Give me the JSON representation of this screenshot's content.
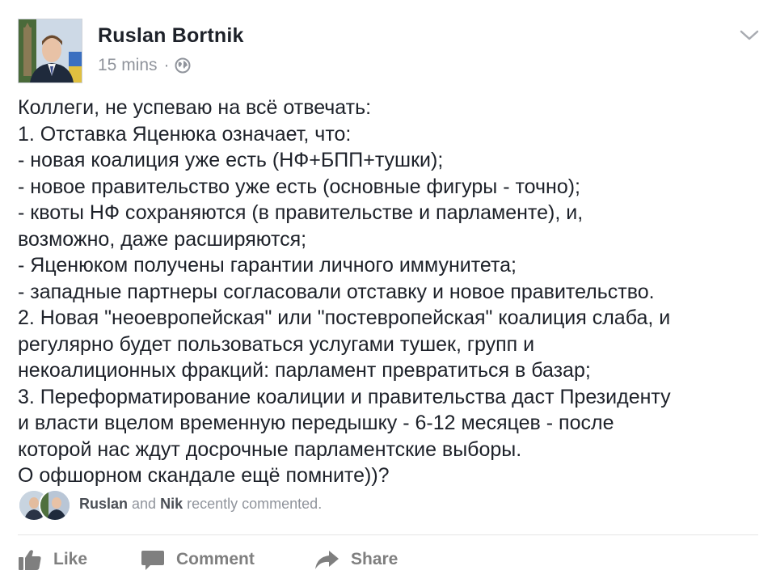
{
  "post": {
    "author": "Ruslan Bortnik",
    "time": "15 mins",
    "separator": "·",
    "privacy_icon": "globe-icon",
    "menu_icon": "chevron-down-icon",
    "lines": [
      "Коллеги, не успеваю на всё отвечать:",
      "1. Отставка Яценюка означает, что:",
      "- новая коалиция уже есть (НФ+БПП+тушки);",
      "- новое правительство уже есть (основные фигуры - точно);",
      "- квоты НФ сохраняются (в правительстве и парламенте), и,",
      "возможно, даже расширяются;",
      "- Яценюком получены гарантии личного иммунитета;",
      "- западные партнеры согласовали отставку и новое правительство.",
      "2. Новая \"неоевропейская\" или \"постевропейская\" коалиция слаба, и",
      "регулярно будет пользоваться услугами тушек, групп и",
      "некоалиционных фракций: парламент превратиться в базар;",
      "3. Переформатирование коалиции и правительства даст Президенту",
      "и власти вцелом временную передышку - 6-12 месяцев - после",
      "которой нас ждут досрочные парламентские выборы.",
      "О офшорном скандале ещё помните))?"
    ]
  },
  "activity": {
    "name1": "Ruslan",
    "joiner": "and",
    "name2": "Nik",
    "suffix": "recently commented."
  },
  "actions": {
    "like": "Like",
    "comment": "Comment",
    "share": "Share"
  },
  "colors": {
    "text": "#1d2129",
    "meta": "#90949c",
    "action": "#7f7f7f",
    "divider": "#e5e5e5"
  }
}
